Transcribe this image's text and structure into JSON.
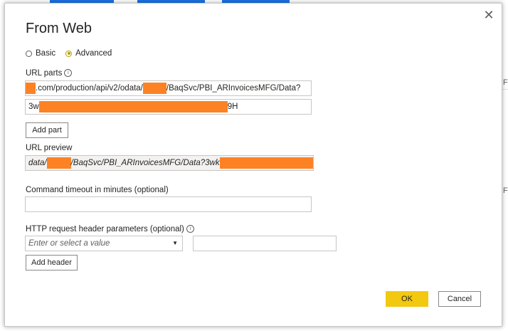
{
  "dialog": {
    "title": "From Web",
    "close_glyph": "✕",
    "mode": {
      "options": [
        {
          "label": "Basic",
          "selected": false
        },
        {
          "label": "Advanced",
          "selected": true
        }
      ]
    },
    "url_parts": {
      "label": "URL parts",
      "part1_value": ".com/production/api/v2/odata/",
      "part1_suffix": "/BaqSvc/PBI_ARInvoicesMFG/Data?",
      "part2_prefix": "3w",
      "part2_suffix": "9H",
      "add_part_label": "Add part"
    },
    "url_preview": {
      "label": "URL preview",
      "value_prefix": "data/",
      "value_middle": "/BaqSvc/PBI_ARInvoicesMFG/Data?3wk"
    },
    "command_timeout": {
      "label": "Command timeout in minutes (optional)",
      "value": ""
    },
    "http_headers": {
      "label": "HTTP request header parameters (optional)",
      "name_placeholder": "Enter or select a value",
      "value": "",
      "add_header_label": "Add header"
    },
    "ok_label": "OK",
    "cancel_label": "Cancel"
  },
  "background": {
    "fi_text_1": "Fi",
    "fi_text_2": "Fi",
    "colors": {
      "tab_blue": "#1a73e8",
      "accent_yellow": "#f2c811",
      "redaction_orange": "#fd8224"
    }
  }
}
